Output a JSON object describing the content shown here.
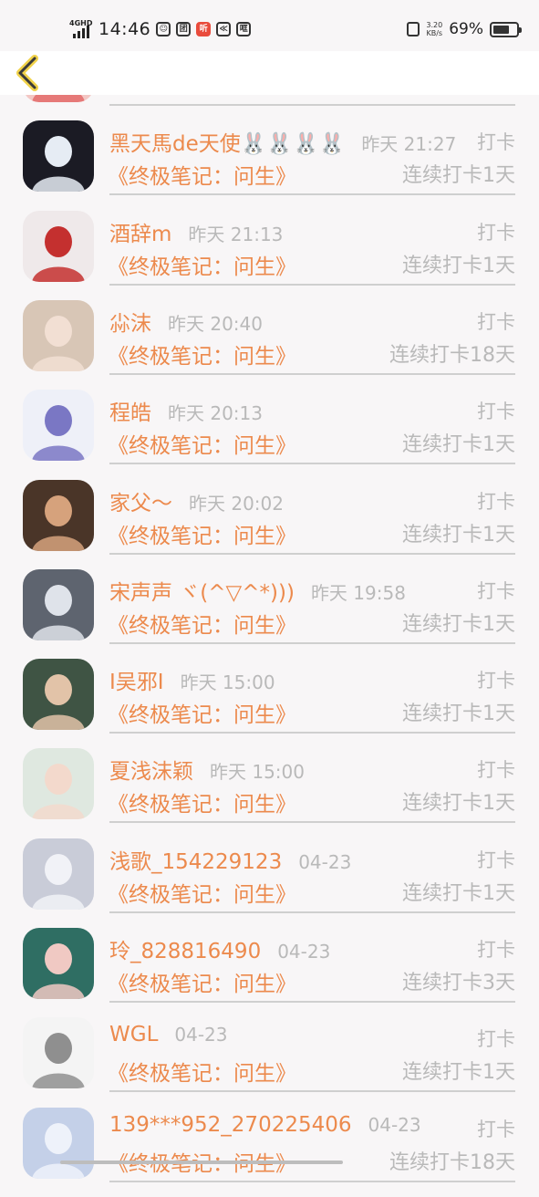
{
  "status_bar": {
    "network": "4GHD",
    "time": "14:46",
    "app_icons": [
      "团",
      "听",
      "≪",
      "哐"
    ],
    "net_speed_value": "3.20",
    "net_speed_unit": "KB/s",
    "battery_percent": "69%",
    "battery_level": 0.69
  },
  "nav": {
    "back_icon": "chevron-left-icon"
  },
  "rows": [
    {
      "name": "",
      "time": "",
      "tag": "",
      "book": "",
      "streak": "",
      "avatar": {
        "bg": "#f3c7c4",
        "fg": "#e36b6b"
      }
    },
    {
      "name": "黑天馬de天使🐰🐰🐰🐰",
      "time": "昨天 21:27",
      "tag": "打卡",
      "book": "《终极笔记：问生》",
      "streak": "连续打卡1天",
      "avatar": {
        "bg": "#1b1b24",
        "fg": "#e6ecf4"
      }
    },
    {
      "name": "酒辞m",
      "time": "昨天 21:13",
      "tag": "打卡",
      "book": "《终极笔记：问生》",
      "streak": "连续打卡1天",
      "avatar": {
        "bg": "#efe9ea",
        "fg": "#c4302f"
      }
    },
    {
      "name": "尛沫",
      "time": "昨天 20:40",
      "tag": "打卡",
      "book": "《终极笔记：问生》",
      "streak": "连续打卡18天",
      "avatar": {
        "bg": "#d8c6b6",
        "fg": "#f2dfd3"
      }
    },
    {
      "name": "程皓",
      "time": "昨天 20:13",
      "tag": "打卡",
      "book": "《终极笔记：问生》",
      "streak": "连续打卡1天",
      "avatar": {
        "bg": "#eef0f8",
        "fg": "#7a77c4"
      }
    },
    {
      "name": "家父～",
      "time": "昨天 20:02",
      "tag": "打卡",
      "book": "《终极笔记：问生》",
      "streak": "连续打卡1天",
      "avatar": {
        "bg": "#4a3528",
        "fg": "#d6a27c"
      }
    },
    {
      "name": "宋声声 ヾ(^▽^*)))",
      "time": "昨天 19:58",
      "tag": "打卡",
      "book": "《终极笔记：问生》",
      "streak": "连续打卡1天",
      "avatar": {
        "bg": "#5e646f",
        "fg": "#dfe3ea"
      }
    },
    {
      "name": "I吴邪I",
      "time": "昨天 15:00",
      "tag": "打卡",
      "book": "《终极笔记：问生》",
      "streak": "连续打卡1天",
      "avatar": {
        "bg": "#3f5444",
        "fg": "#e2c3a8"
      }
    },
    {
      "name": "夏浅沫颖",
      "time": "昨天 15:00",
      "tag": "打卡",
      "book": "《终极笔记：问生》",
      "streak": "连续打卡1天",
      "avatar": {
        "bg": "#dfe8e0",
        "fg": "#f3d9cc"
      }
    },
    {
      "name": "浅歌_154229123",
      "time": "04-23",
      "tag": "打卡",
      "book": "《终极笔记：问生》",
      "streak": "连续打卡1天",
      "avatar": {
        "bg": "#c9ccd8",
        "fg": "#f1f2f7"
      }
    },
    {
      "name": "玲_828816490",
      "time": "04-23",
      "tag": "打卡",
      "book": "《终极笔记：问生》",
      "streak": "连续打卡3天",
      "avatar": {
        "bg": "#2f6e63",
        "fg": "#f0c9c3"
      }
    },
    {
      "name": "WGL",
      "time": "04-23",
      "tag": "打卡",
      "book": "《终极笔记：问生》",
      "streak": "连续打卡1天",
      "avatar": {
        "bg": "#f4f4f4",
        "fg": "#8f8f8f"
      }
    },
    {
      "name": "139***952_270225406",
      "time": "04-23",
      "tag": "打卡",
      "book": "《终极笔记：问生》",
      "streak": "连续打卡18天",
      "avatar": {
        "bg": "#c4d0e8",
        "fg": "#eef2fa"
      }
    }
  ]
}
